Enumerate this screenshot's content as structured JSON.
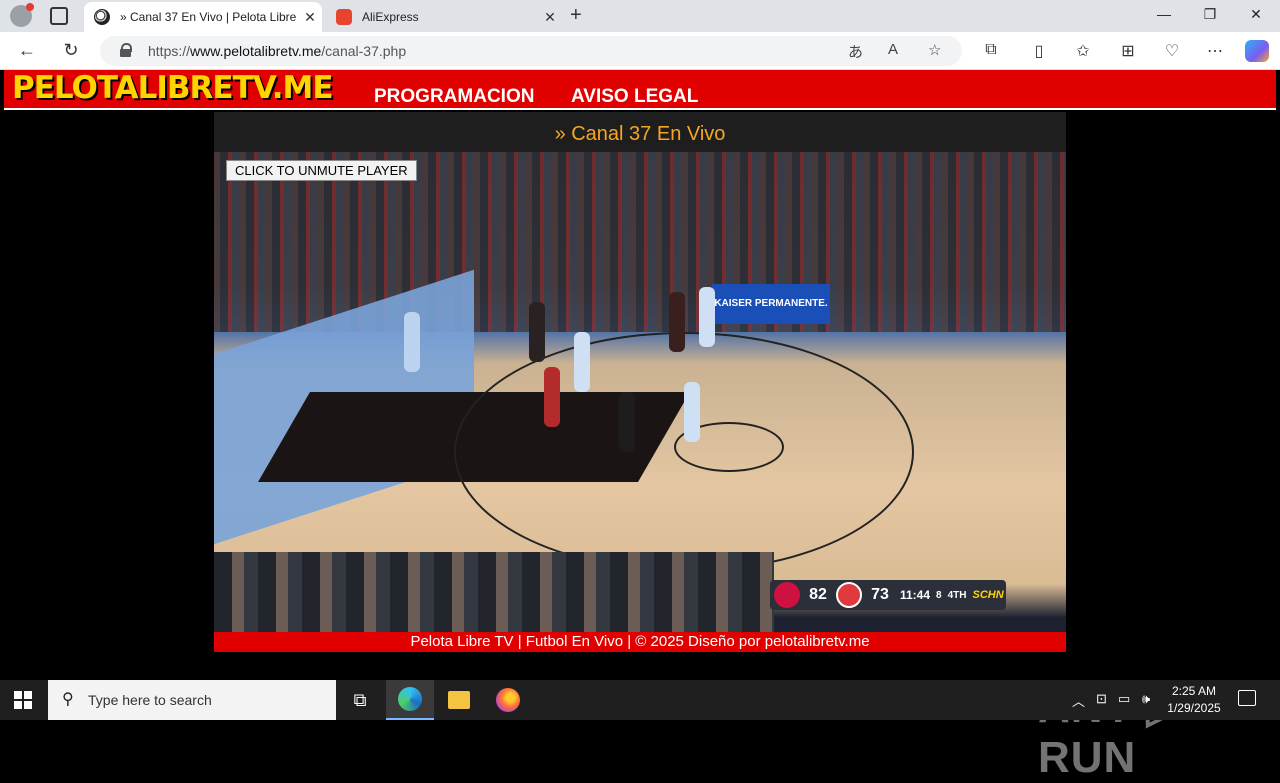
{
  "browser": {
    "tabs": [
      {
        "title": "» Canal 37 En Vivo | Pelota Libre TV",
        "active": true
      },
      {
        "title": "AliExpress",
        "active": false
      }
    ],
    "url_prefix": "https://",
    "url_domain": "www.pelotalibretv.me",
    "url_path": "/canal-37.php"
  },
  "site": {
    "logo": "PELOTALIBRETV.ME",
    "menu": [
      "PROGRAMACION",
      "AVISO LEGAL"
    ],
    "page_title": "» Canal 37 En Vivo",
    "unmute_label": "CLICK TO UNMUTE PLAYER",
    "footer": "Pelota Libre TV | Futbol En Vivo | © 2025 Diseño por pelotalibretv.me"
  },
  "video": {
    "kaiser_sign": "KAISER PERMANENTE.",
    "scorebug": {
      "home_score": "82",
      "away_score": "73",
      "clock": "11:44",
      "shot_clock": "8",
      "quarter": "4TH",
      "network": "SCHN"
    }
  },
  "watermark": "ANY ▷ RUN",
  "taskbar": {
    "search_placeholder": "Type here to search",
    "time": "2:25 AM",
    "date": "1/29/2025"
  },
  "colors": {
    "site_red": "#e10000",
    "logo_yellow": "#ffd400",
    "title_orange": "#f5a623"
  }
}
